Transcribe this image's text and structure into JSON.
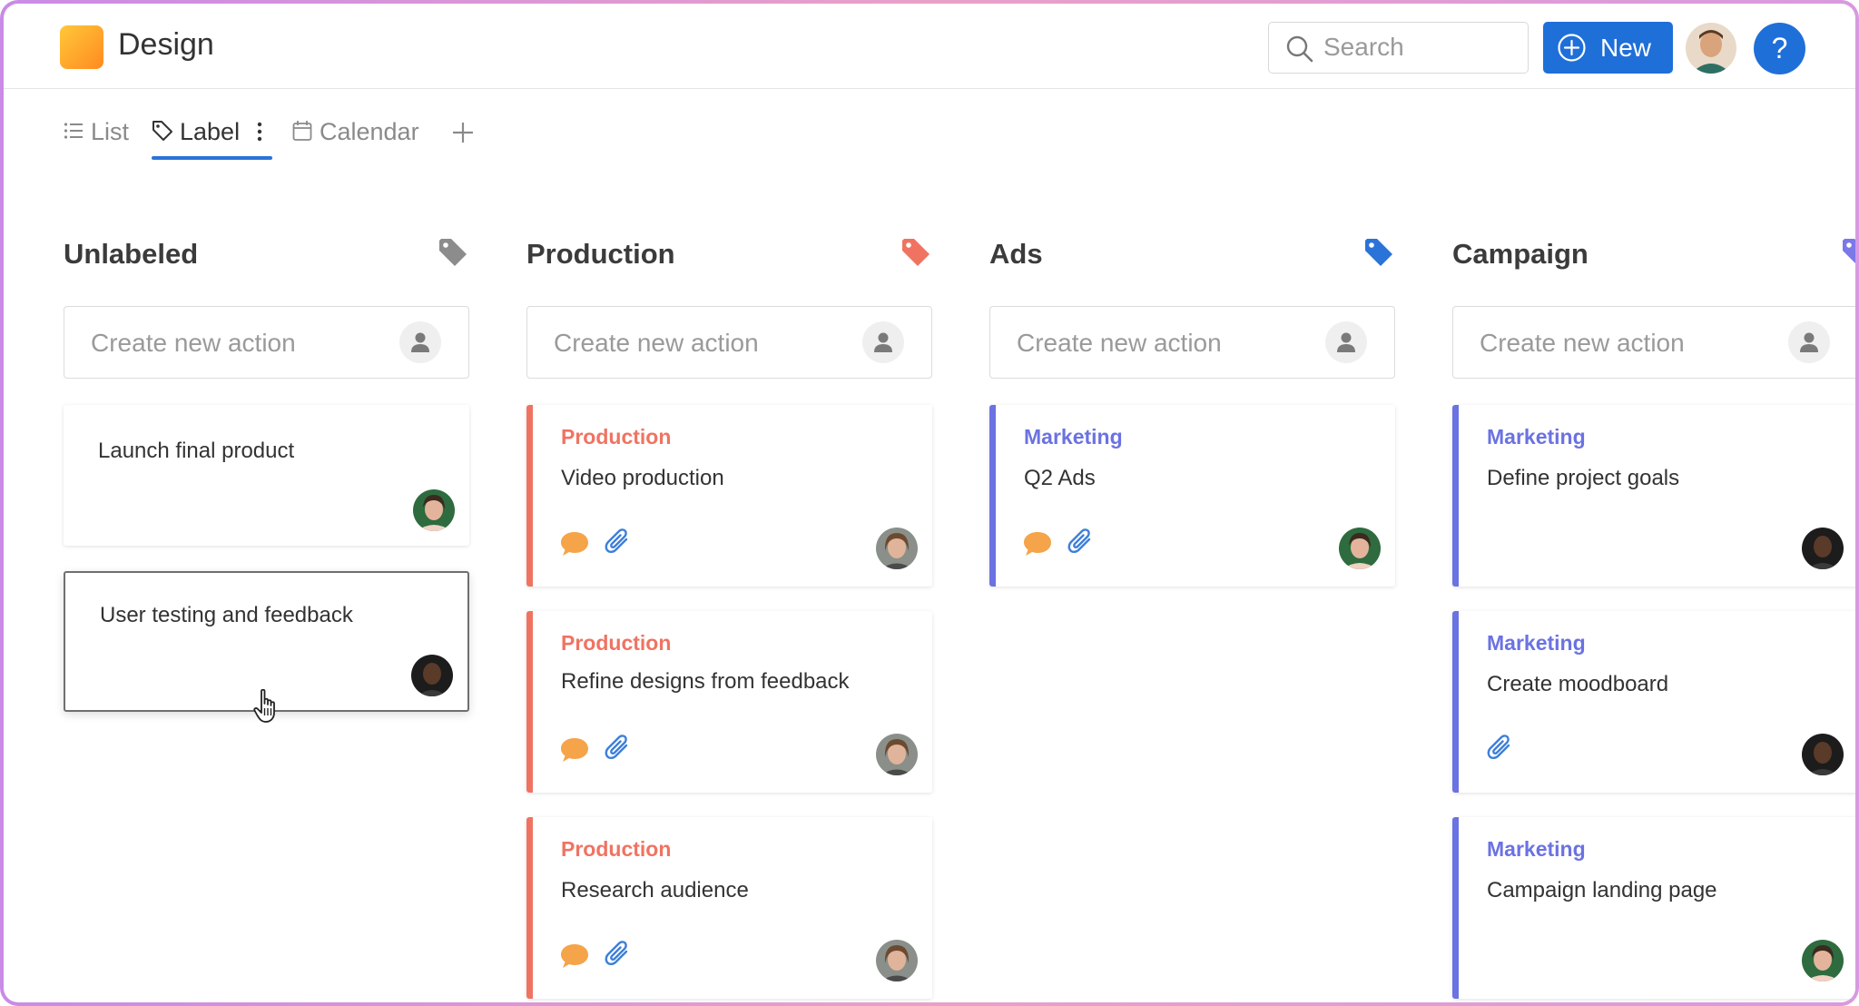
{
  "app": {
    "title": "Design"
  },
  "header": {
    "search_placeholder": "Search",
    "new_label": "New",
    "help_label": "?"
  },
  "tabs": [
    {
      "label": "List",
      "icon": "list-icon"
    },
    {
      "label": "Label",
      "icon": "tag-icon",
      "active": true
    },
    {
      "label": "Calendar",
      "icon": "calendar-icon"
    }
  ],
  "colors": {
    "accent": "#1f6fd8",
    "production": "#f07362",
    "marketing": "#6b72e2",
    "unlabeled_tag": "#8c8c8c",
    "ads_tag": "#2a73d8",
    "campaign_tag": "#7b78e8"
  },
  "create_placeholder": "Create new action",
  "columns": [
    {
      "title": "Unlabeled",
      "cards": [
        {
          "title": "Launch final product"
        },
        {
          "title": "User testing and feedback"
        }
      ]
    },
    {
      "title": "Production",
      "cards": [
        {
          "label": "Production",
          "title": "Video production"
        },
        {
          "label": "Production",
          "title": "Refine designs from feedback"
        },
        {
          "label": "Production",
          "title": "Research audience"
        }
      ]
    },
    {
      "title": "Ads",
      "cards": [
        {
          "label": "Marketing",
          "title": "Q2 Ads"
        }
      ]
    },
    {
      "title": "Campaign",
      "cards": [
        {
          "label": "Marketing",
          "title": "Define project goals"
        },
        {
          "label": "Marketing",
          "title": "Create moodboard"
        },
        {
          "label": "Marketing",
          "title": "Campaign landing page"
        }
      ]
    }
  ]
}
